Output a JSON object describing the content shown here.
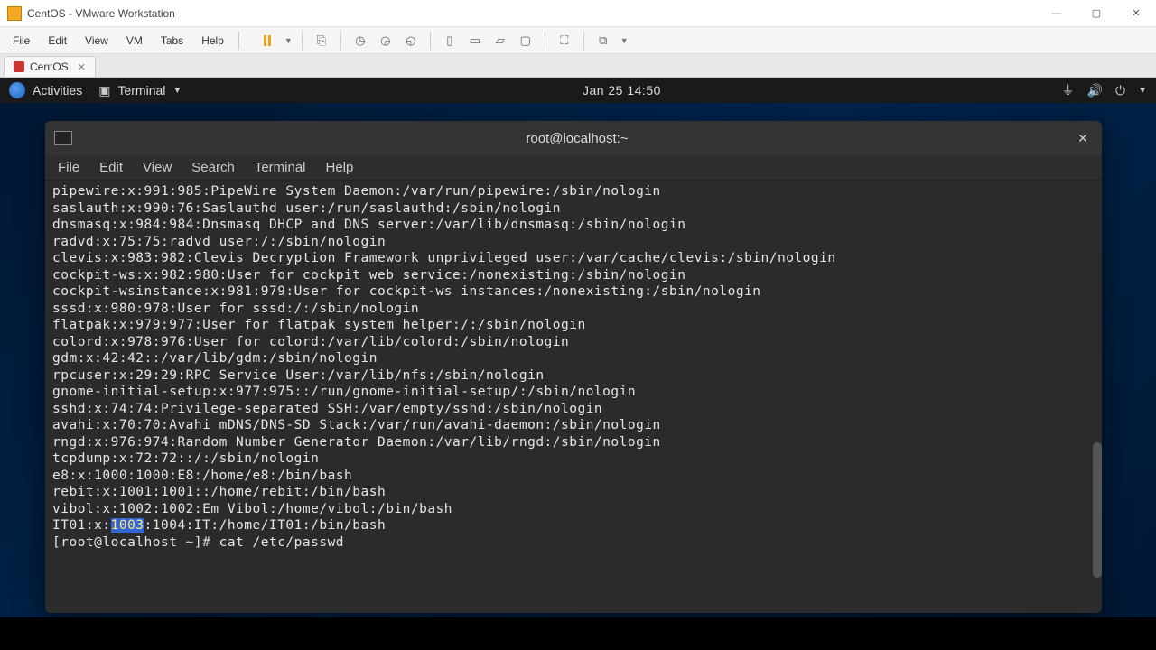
{
  "vmware": {
    "title": "CentOS - VMware Workstation",
    "menu": [
      "File",
      "Edit",
      "View",
      "VM",
      "Tabs",
      "Help"
    ],
    "tab_label": "CentOS",
    "window_controls": {
      "min": "—",
      "max": "▢",
      "close": "✕"
    }
  },
  "gnome": {
    "activities": "Activities",
    "terminal_label": "Terminal",
    "datetime": "Jan 25  14:50"
  },
  "terminal": {
    "title": "root@localhost:~",
    "menu": [
      "File",
      "Edit",
      "View",
      "Search",
      "Terminal",
      "Help"
    ],
    "lines": [
      "pipewire:x:991:985:PipeWire System Daemon:/var/run/pipewire:/sbin/nologin",
      "saslauth:x:990:76:Saslauthd user:/run/saslauthd:/sbin/nologin",
      "dnsmasq:x:984:984:Dnsmasq DHCP and DNS server:/var/lib/dnsmasq:/sbin/nologin",
      "radvd:x:75:75:radvd user:/:/sbin/nologin",
      "clevis:x:983:982:Clevis Decryption Framework unprivileged user:/var/cache/clevis:/sbin/nologin",
      "cockpit-ws:x:982:980:User for cockpit web service:/nonexisting:/sbin/nologin",
      "cockpit-wsinstance:x:981:979:User for cockpit-ws instances:/nonexisting:/sbin/nologin",
      "sssd:x:980:978:User for sssd:/:/sbin/nologin",
      "flatpak:x:979:977:User for flatpak system helper:/:/sbin/nologin",
      "colord:x:978:976:User for colord:/var/lib/colord:/sbin/nologin",
      "gdm:x:42:42::/var/lib/gdm:/sbin/nologin",
      "rpcuser:x:29:29:RPC Service User:/var/lib/nfs:/sbin/nologin",
      "gnome-initial-setup:x:977:975::/run/gnome-initial-setup/:/sbin/nologin",
      "sshd:x:74:74:Privilege-separated SSH:/var/empty/sshd:/sbin/nologin",
      "avahi:x:70:70:Avahi mDNS/DNS-SD Stack:/var/run/avahi-daemon:/sbin/nologin",
      "rngd:x:976:974:Random Number Generator Daemon:/var/lib/rngd:/sbin/nologin",
      "tcpdump:x:72:72::/:/sbin/nologin",
      "e8:x:1000:1000:E8:/home/e8:/bin/bash",
      "rebit:x:1001:1001::/home/rebit:/bin/bash",
      "vibol:x:1002:1002:Em Vibol:/home/vibol:/bin/bash"
    ],
    "line_it01": {
      "pre": "IT01:x:",
      "sel": "1003",
      "post": ":1004:IT:/home/IT01:/bin/bash"
    },
    "prompt": "[root@localhost ~]# cat /etc/passwd"
  }
}
